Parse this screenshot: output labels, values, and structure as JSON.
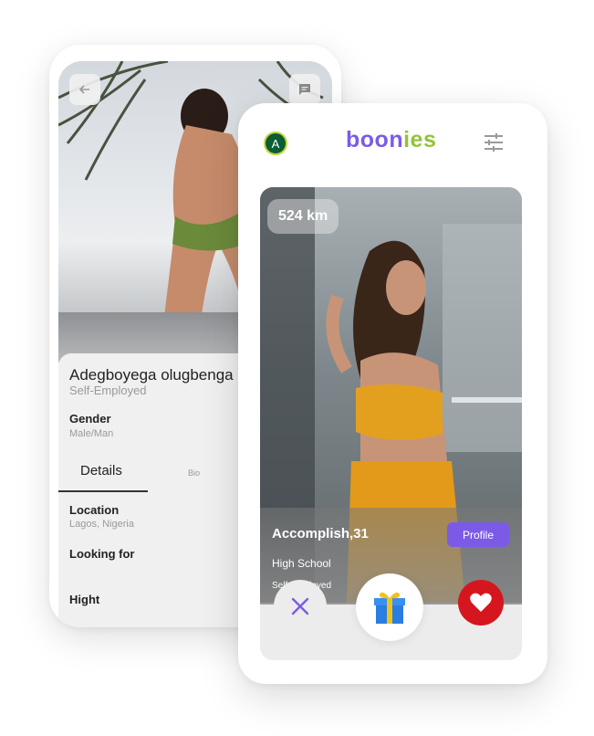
{
  "profile_screen": {
    "name": "Adegboyega olugbenga",
    "occupation": "Self-Employed",
    "gender_label": "Gender",
    "gender_value": "Male/Man",
    "tabs": [
      {
        "label": "Details"
      },
      {
        "label": "Bio"
      }
    ],
    "location_label": "Location",
    "location_value": "Lagos, Nigeria",
    "looking_for_label": "Looking for",
    "height_label": "Hight"
  },
  "swipe_screen": {
    "avatar_initial": "A",
    "brand": {
      "part1": "boon",
      "part2": "ies"
    },
    "distance": "524 km",
    "card": {
      "name_age": "Accomplish,31",
      "education": "High School",
      "occupation": "Self-Employed",
      "profile_button": "Profile"
    },
    "actions": [
      "close-icon",
      "gift-icon",
      "heart-icon"
    ]
  },
  "colors": {
    "brand_purple": "#7b5be6",
    "brand_green": "#93c23a",
    "like_red": "#d6161f",
    "avatar_green": "#0b5d35"
  }
}
